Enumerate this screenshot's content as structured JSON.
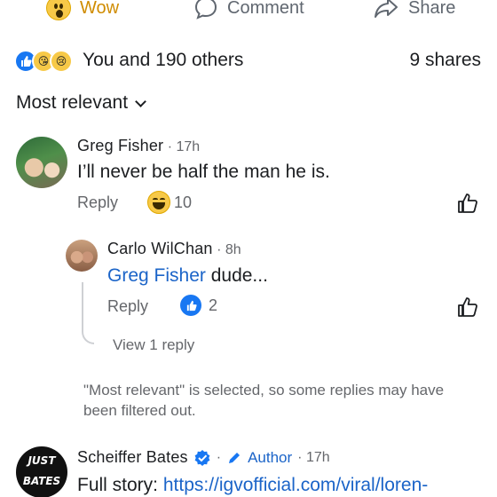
{
  "actions": {
    "wow_label": "Wow",
    "comment_label": "Comment",
    "share_label": "Share"
  },
  "reactions_summary": {
    "text": "You and 190 others",
    "shares": "9 shares"
  },
  "sort": {
    "label": "Most relevant"
  },
  "comments": [
    {
      "name": "Greg Fisher",
      "time": "· 17h",
      "text": "I’ll never be half the man he is.",
      "reply_label": "Reply",
      "reaction_count": "10"
    }
  ],
  "reply": {
    "name": "Carlo WilChan",
    "time": "· 8h",
    "mention": "Greg Fisher",
    "text": " dude...",
    "reply_label": "Reply",
    "reaction_count": "2",
    "view_replies": "View 1 reply"
  },
  "notice": "\"Most relevant\" is selected, so some replies may have been filtered out.",
  "author_comment": {
    "name": "Scheiffer Bates",
    "author_badge": "Author",
    "time": "· 17h",
    "sep": "·",
    "text_prefix": "Full story: ",
    "link": "https://igvofficial.com/viral/loren-",
    "logo_top": "JUST",
    "logo_bottom": "BATES"
  },
  "colors": {
    "accent": "#1877f2",
    "link": "#1b64c8",
    "muted": "#65676b"
  }
}
